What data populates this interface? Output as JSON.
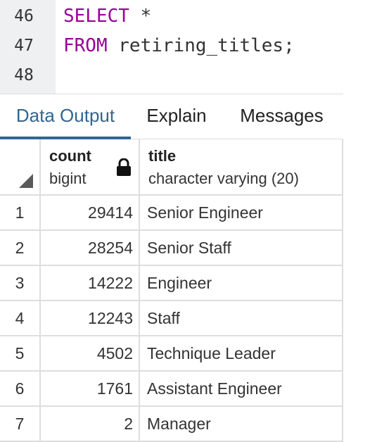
{
  "editor": {
    "lines": [
      {
        "num": "46",
        "kw": "SELECT",
        "rest": " *"
      },
      {
        "num": "47",
        "kw": "FROM",
        "rest": " retiring_titles;"
      },
      {
        "num": "48",
        "kw": "",
        "rest": ""
      }
    ],
    "keyword_color": "#990099"
  },
  "tabs": {
    "items": [
      {
        "label": "Data Output"
      },
      {
        "label": "Explain"
      },
      {
        "label": "Messages"
      }
    ],
    "active": "Data Output",
    "accent": "#326690"
  },
  "grid": {
    "columns": [
      {
        "name": "count",
        "type": "bigint",
        "locked": true
      },
      {
        "name": "title",
        "type": "character varying (20)",
        "locked": false
      }
    ],
    "rows": [
      {
        "n": "1",
        "count": "29414",
        "title": "Senior Engineer"
      },
      {
        "n": "2",
        "count": "28254",
        "title": "Senior Staff"
      },
      {
        "n": "3",
        "count": "14222",
        "title": "Engineer"
      },
      {
        "n": "4",
        "count": "12243",
        "title": "Staff"
      },
      {
        "n": "5",
        "count": "4502",
        "title": "Technique Leader"
      },
      {
        "n": "6",
        "count": "1761",
        "title": "Assistant Engineer"
      },
      {
        "n": "7",
        "count": "2",
        "title": "Manager"
      }
    ]
  }
}
